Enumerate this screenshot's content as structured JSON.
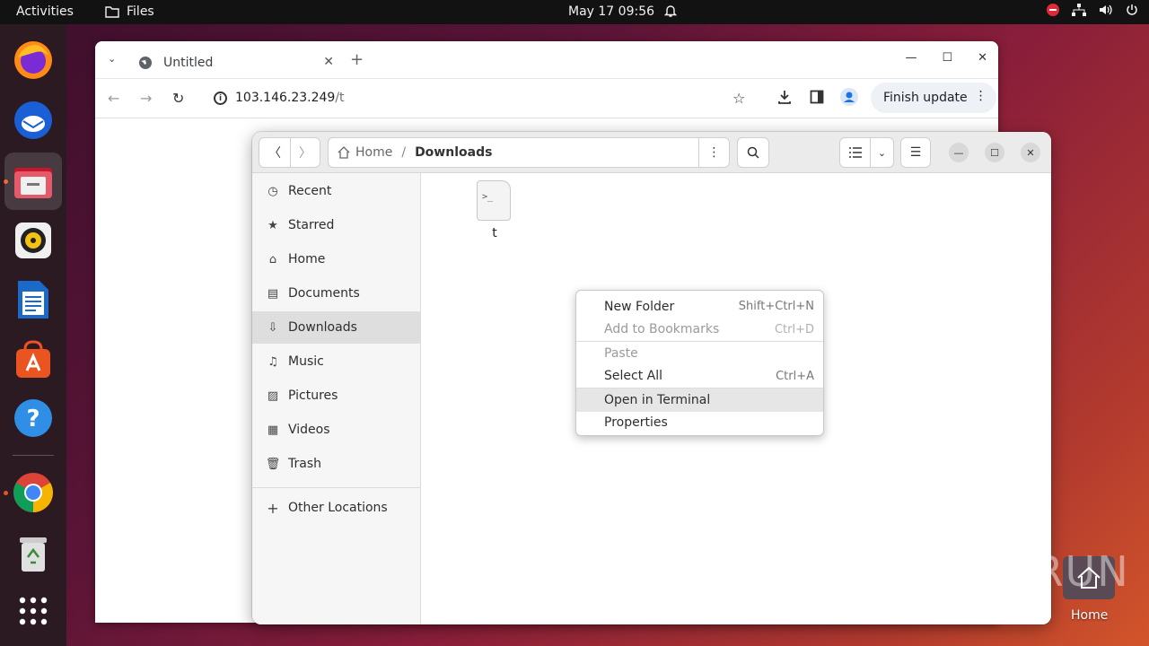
{
  "topbar": {
    "activities": "Activities",
    "app_name": "Files",
    "clock": "May 17  09:56"
  },
  "browser": {
    "tab_title": "Untitled",
    "url_host": "103.146.23.249",
    "url_path": "/t",
    "finish_update": "Finish update"
  },
  "files": {
    "path_home": "Home",
    "path_current": "Downloads",
    "sidebar": [
      {
        "label": "Recent",
        "icon": "clock-icon"
      },
      {
        "label": "Starred",
        "icon": "star-icon"
      },
      {
        "label": "Home",
        "icon": "home-icon"
      },
      {
        "label": "Documents",
        "icon": "document-icon"
      },
      {
        "label": "Downloads",
        "icon": "download-icon"
      },
      {
        "label": "Music",
        "icon": "music-icon"
      },
      {
        "label": "Pictures",
        "icon": "picture-icon"
      },
      {
        "label": "Videos",
        "icon": "video-icon"
      },
      {
        "label": "Trash",
        "icon": "trash-icon"
      }
    ],
    "other_locations": "Other Locations",
    "file": {
      "name": "t",
      "glyph": ">_"
    }
  },
  "context_menu": {
    "items": [
      {
        "label": "New Folder",
        "accel": "Shift+Ctrl+N"
      },
      {
        "label": "Add to Bookmarks",
        "accel": "Ctrl+D"
      },
      {
        "label": "Paste",
        "accel": ""
      },
      {
        "label": "Select All",
        "accel": "Ctrl+A"
      },
      {
        "label": "Open in Terminal",
        "accel": ""
      },
      {
        "label": "Properties",
        "accel": ""
      }
    ]
  },
  "desktop": {
    "home_label": "Home",
    "watermark": "ANY RUN"
  },
  "colors": {
    "accent": "#e95420",
    "topbar": "#121212",
    "dock": "#2b1a22"
  }
}
